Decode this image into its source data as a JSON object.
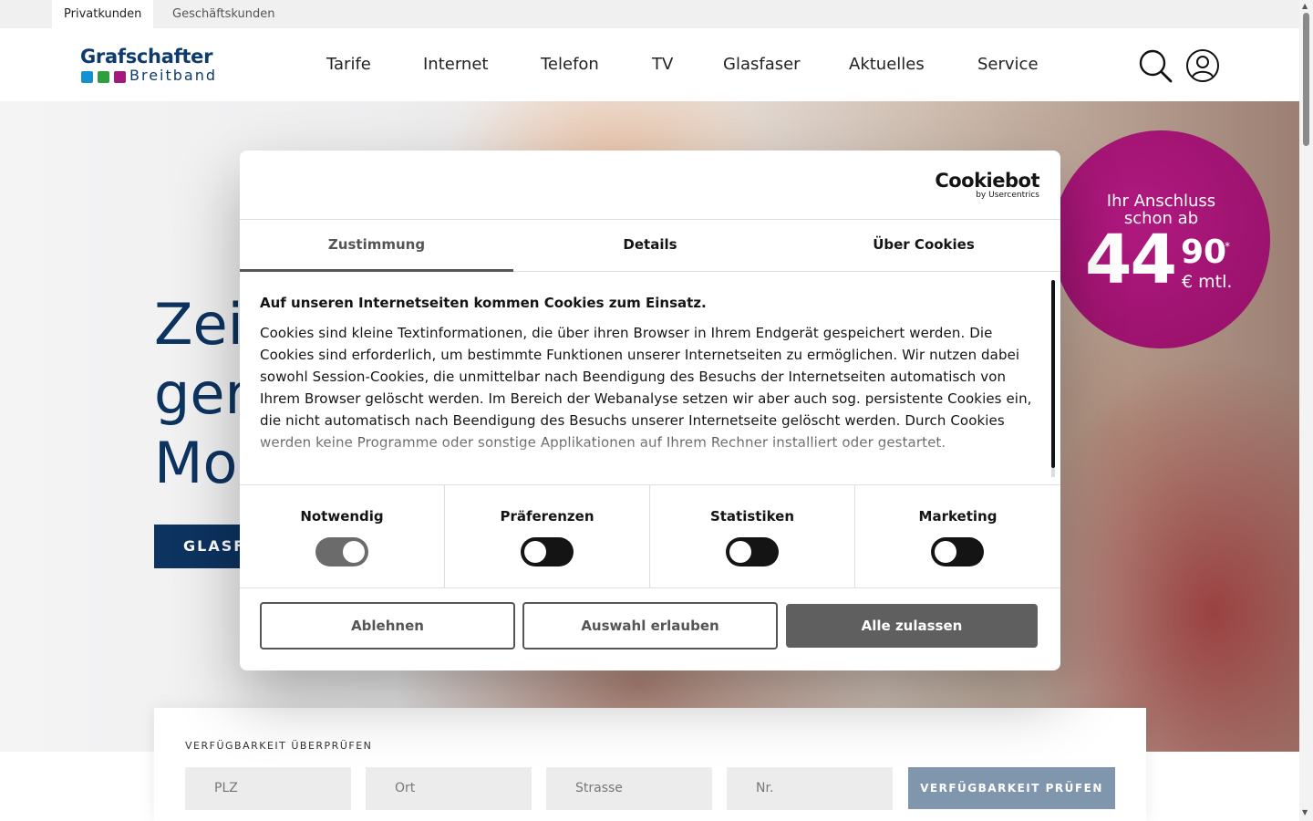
{
  "topbar": {
    "tabs": [
      {
        "label": "Privatkunden"
      },
      {
        "label": "Geschäftskunden"
      }
    ]
  },
  "logo": {
    "brand": "Grafschafter",
    "sub": "Breitband",
    "colors": [
      "#1590d3",
      "#2e9f3e",
      "#a5187c"
    ]
  },
  "nav": {
    "items": [
      "Tarife",
      "Internet",
      "Telefon",
      "TV",
      "Glasfaser",
      "Aktuelles",
      "Service"
    ]
  },
  "icons": {
    "search": "search-icon",
    "account": "user-icon"
  },
  "hero": {
    "title_lines": [
      "Zei",
      "ger",
      "Mo"
    ],
    "button_label": "GLASF"
  },
  "price_badge": {
    "line1": "Ihr Anschluss",
    "line2": "schon ab",
    "euros": "44",
    "cents": "90",
    "star": "*",
    "unit": "€ mtl.",
    "color": "#a5187c"
  },
  "availability": {
    "label": "VERFÜGBARKEIT ÜBERPRÜFEN",
    "fields": [
      {
        "placeholder": "PLZ"
      },
      {
        "placeholder": "Ort"
      },
      {
        "placeholder": "Strasse"
      },
      {
        "placeholder": "Nr."
      }
    ],
    "button": "VERFÜGBARKEIT PRÜFEN"
  },
  "cookie_dialog": {
    "brand": "Cookiebot",
    "brand_sub": "by Usercentrics",
    "tabs": [
      {
        "label": "Zustimmung",
        "active": true
      },
      {
        "label": "Details",
        "active": false
      },
      {
        "label": "Über Cookies",
        "active": false
      }
    ],
    "heading": "Auf unseren Internetseiten kommen Cookies zum Einsatz.",
    "body": "Cookies sind kleine Textinformationen, die über ihren Browser in Ihrem Endgerät gespeichert werden. Die Cookies sind erforderlich, um bestimmte Funktionen unserer Internetseiten zu ermöglichen. Wir nutzen dabei sowohl Session-Cookies, die unmittelbar nach Beendigung des Besuchs der Internetseiten automatisch von Ihrem Browser gelöscht werden. Im Bereich der Webanalyse setzen wir aber auch sog. persistente Cookies ein, die nicht automatisch nach Beendigung des Besuchs unserer Internetseite gelöscht werden. Durch Cookies werden keine Programme oder sonstige Applikationen auf Ihrem Rechner installiert oder gestartet.",
    "toggles": [
      {
        "label": "Notwendig",
        "on": true,
        "disabled": true
      },
      {
        "label": "Präferenzen",
        "on": false,
        "disabled": false
      },
      {
        "label": "Statistiken",
        "on": false,
        "disabled": false
      },
      {
        "label": "Marketing",
        "on": false,
        "disabled": false
      }
    ],
    "buttons": {
      "decline": "Ablehnen",
      "allow_selection": "Auswahl erlauben",
      "allow_all": "Alle zulassen"
    }
  }
}
